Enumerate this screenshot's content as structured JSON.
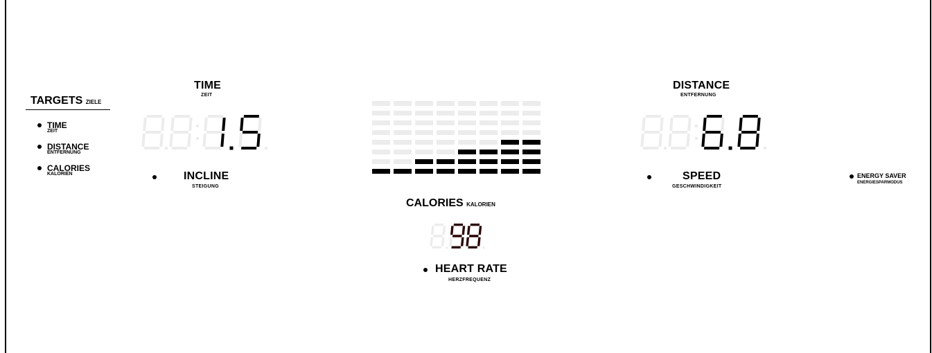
{
  "targets": {
    "title": "TARGETS",
    "title_sub": "ZIELE",
    "items": [
      {
        "label": "TIME",
        "sub": "ZEIT"
      },
      {
        "label": "DISTANCE",
        "sub": "ENTFERNUNG"
      },
      {
        "label": "CALORIES",
        "sub": "KALORIEN"
      }
    ]
  },
  "time": {
    "label": "TIME",
    "sub": "ZEIT",
    "value": "1.5"
  },
  "incline": {
    "label": "INCLINE",
    "sub": "STEIGUNG"
  },
  "distance": {
    "label": "DISTANCE",
    "sub": "ENTFERNUNG",
    "value": "6.8"
  },
  "speed": {
    "label": "SPEED",
    "sub": "GESCHWINDIGKEIT"
  },
  "energy_saver": {
    "label": "ENERGY SAVER",
    "sub": "ENERGIESPARMODUS"
  },
  "calories": {
    "label": "CALORIES",
    "sub": "KALORIEN",
    "value": "98"
  },
  "heart_rate": {
    "label": "HEART RATE",
    "sub": "HERZFREQUENZ"
  },
  "profile_bars": {
    "columns": 8,
    "rows": 8,
    "levels": [
      1,
      1,
      2,
      2,
      3,
      3,
      4,
      4
    ]
  },
  "colors": {
    "active": "#000000",
    "ghost": "#ececec",
    "calorie_digits": "#2a0505"
  }
}
